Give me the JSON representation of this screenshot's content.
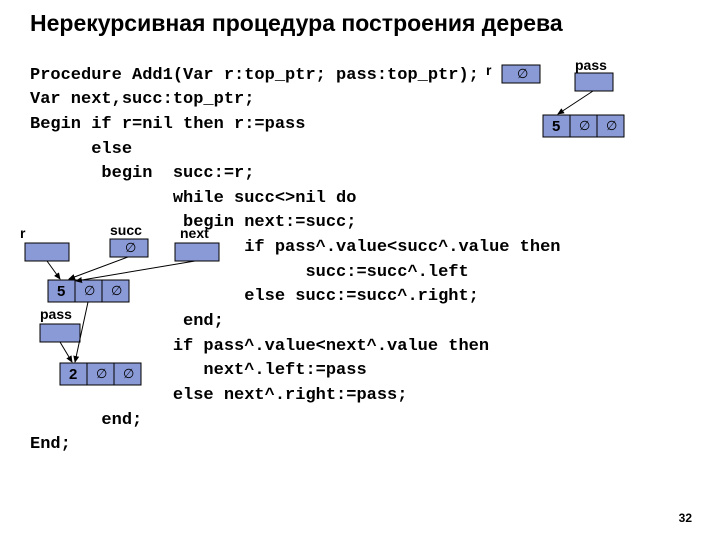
{
  "title": "Нерекурсивная процедура построения дерева",
  "code": {
    "l1": "Procedure Add1(Var r:top_ptr; pass:top_ptr);",
    "l2": "Var next,succ:top_ptr;",
    "l3": "Begin if r=nil then r:=pass",
    "l4": "      else",
    "l5": "       begin  succ:=r;",
    "l6": "              while succ<>nil do",
    "l7": "               begin next:=succ;",
    "l8": "                     if pass^.value<succ^.value then",
    "l9": "                           succ:=succ^.left",
    "l10": "                     else succ:=succ^.right;",
    "l11": "               end;",
    "l12": "              if pass^.value<next^.value then",
    "l13": "                 next^.left:=pass",
    "l14": "              else next^.right:=pass;",
    "l15": "       end;",
    "l16": "End;"
  },
  "diag1": {
    "labels": {
      "r": "r",
      "pass": "pass"
    },
    "node": {
      "val": "5",
      "left": "∅",
      "right": "∅"
    },
    "rbox": "∅"
  },
  "diag2": {
    "labels": {
      "r": "r",
      "succ": "succ",
      "next": "next",
      "pass": "pass"
    },
    "node5": {
      "val": "5",
      "left": "∅",
      "right": "∅"
    },
    "node2": {
      "val": "2",
      "left": "∅",
      "right": "∅"
    },
    "succbox": "∅"
  },
  "page": "32"
}
